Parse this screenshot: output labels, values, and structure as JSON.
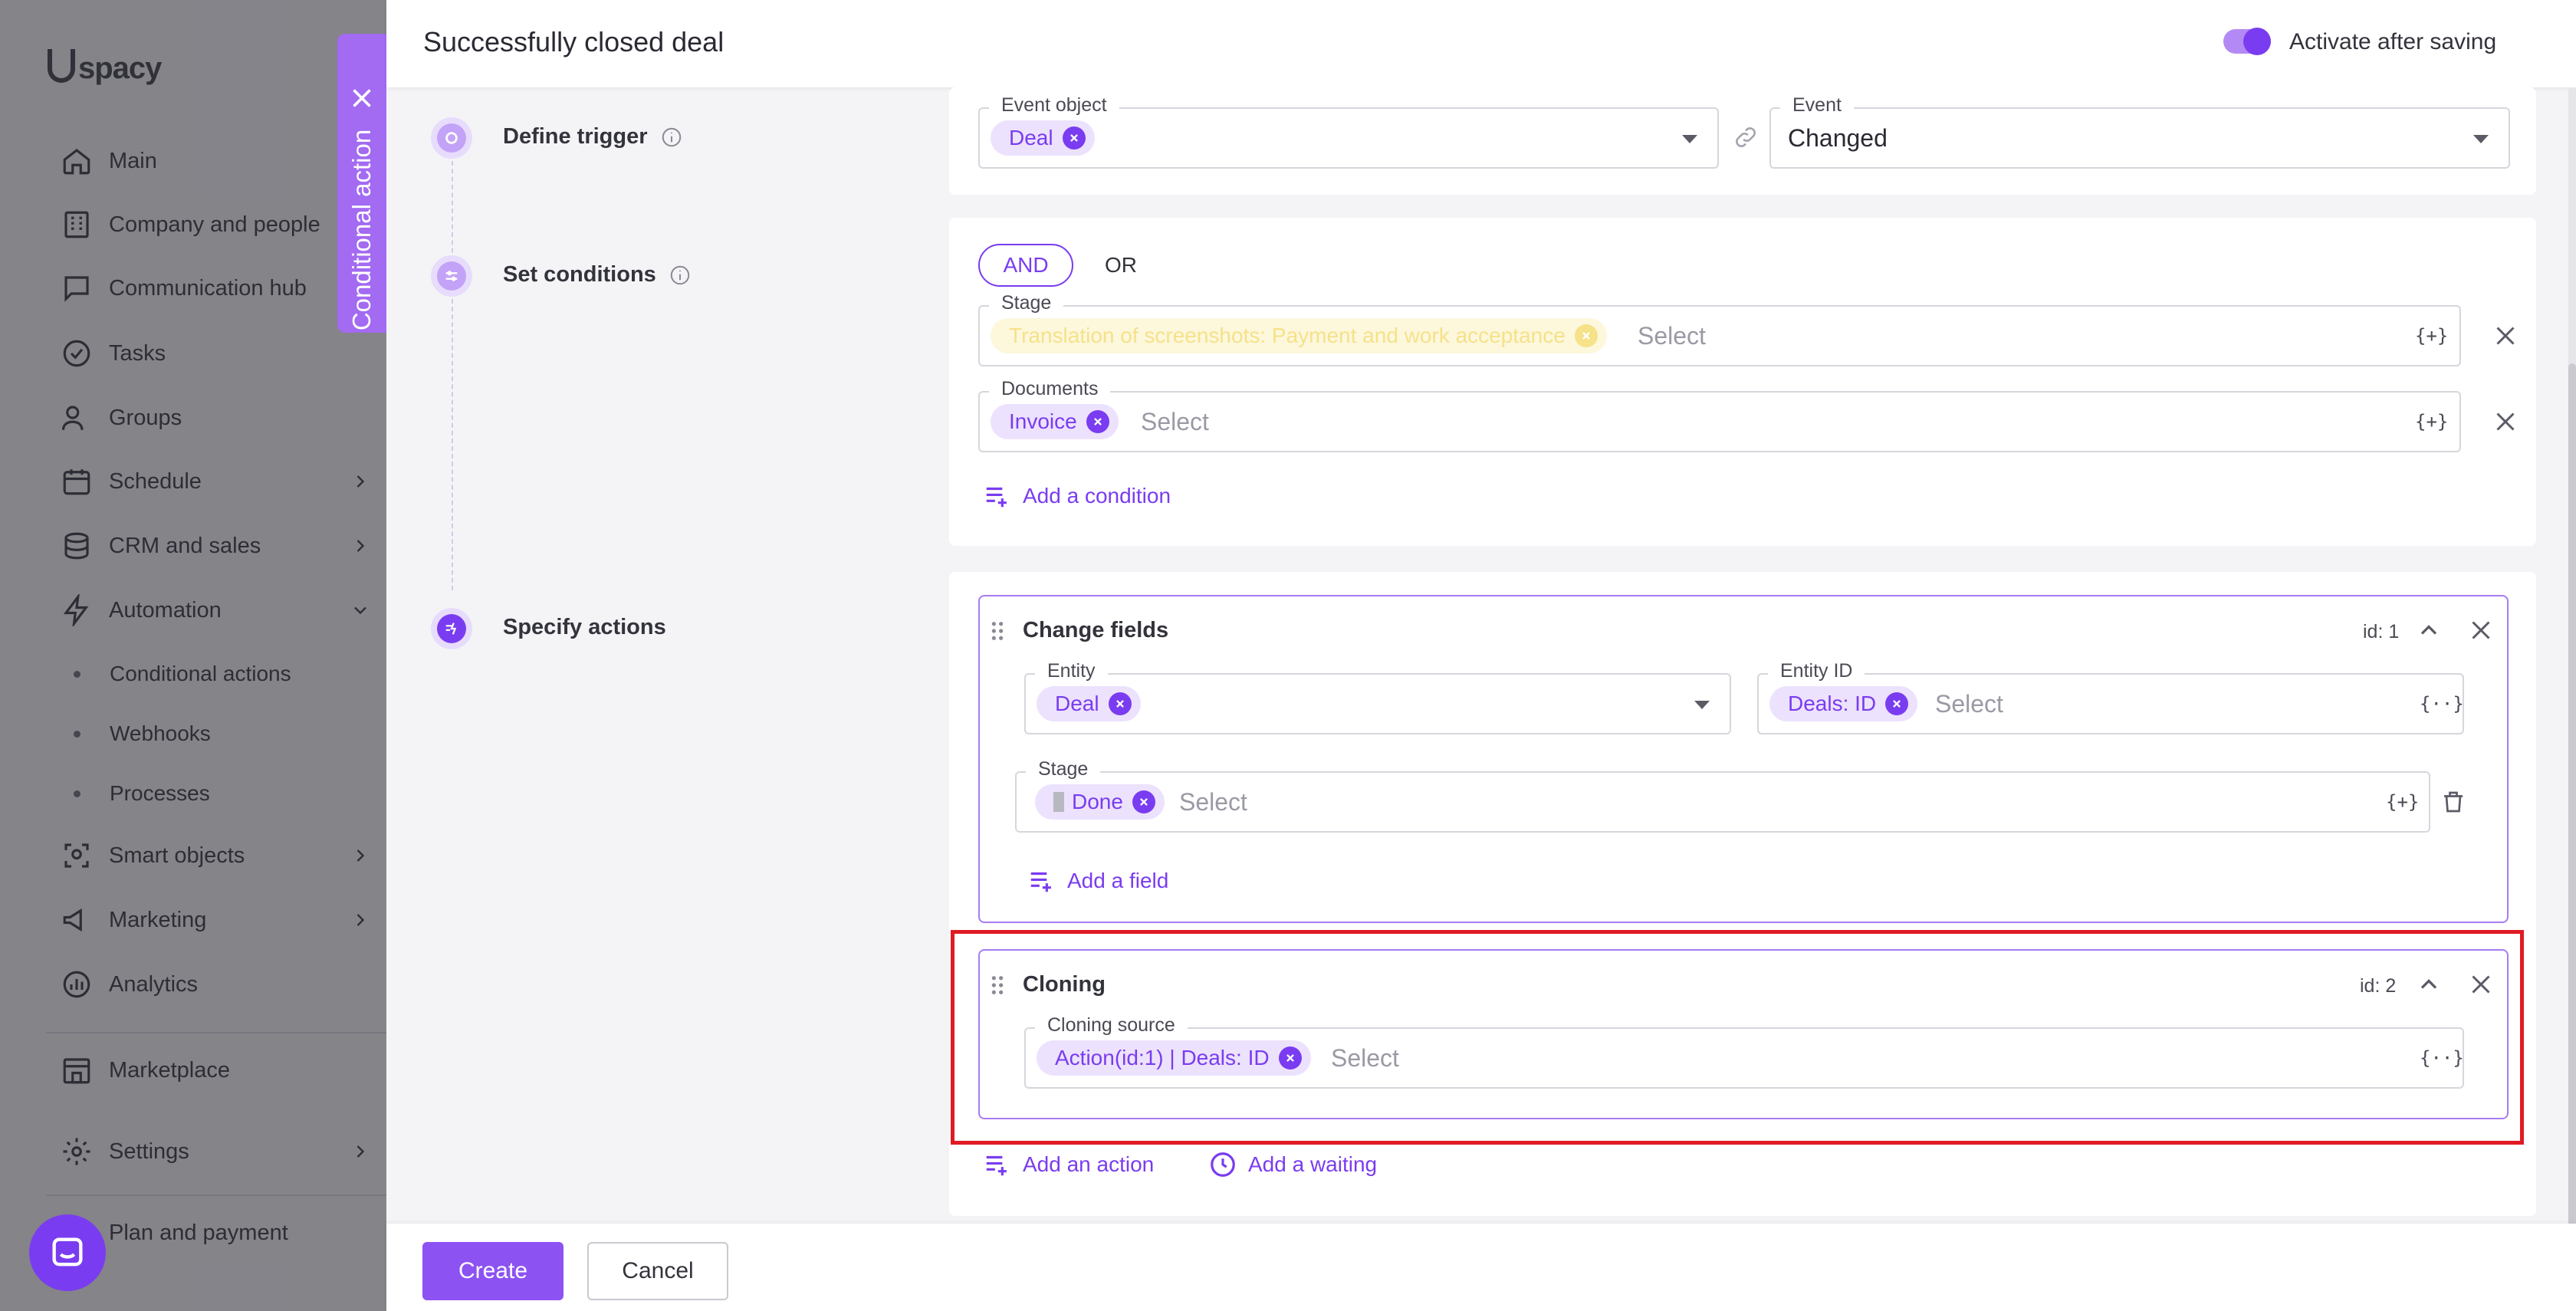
{
  "sidebar": {
    "logo": "spacy",
    "items": [
      {
        "label": "Main",
        "icon": "home-icon"
      },
      {
        "label": "Company and people",
        "icon": "building-icon"
      },
      {
        "label": "Communication hub",
        "icon": "chat-icon"
      },
      {
        "label": "Tasks",
        "icon": "check-circle-icon"
      },
      {
        "label": "Groups",
        "icon": "users-icon"
      },
      {
        "label": "Schedule",
        "icon": "calendar-icon"
      },
      {
        "label": "CRM and sales",
        "icon": "database-icon"
      },
      {
        "label": "Automation",
        "icon": "lightning-icon"
      },
      {
        "label": "Smart objects",
        "icon": "scan-icon"
      },
      {
        "label": "Marketing",
        "icon": "megaphone-icon"
      },
      {
        "label": "Analytics",
        "icon": "chart-icon"
      },
      {
        "label": "Marketplace",
        "icon": "store-icon"
      },
      {
        "label": "Settings",
        "icon": "gear-icon"
      },
      {
        "label": "Plan and payment",
        "icon": "card-icon"
      }
    ],
    "automation_sub": [
      "Conditional actions",
      "Webhooks",
      "Processes"
    ]
  },
  "vertical_tab": {
    "label": "Conditional action"
  },
  "header": {
    "title": "Successfully closed deal",
    "activate_label": "Activate after saving",
    "activate_on": true
  },
  "steps": {
    "trigger": "Define trigger",
    "conditions": "Set conditions",
    "actions": "Specify actions"
  },
  "trigger": {
    "event_object_label": "Event object",
    "event_object_chip": "Deal",
    "event_label": "Event",
    "event_value": "Changed"
  },
  "conditions": {
    "and_label": "AND",
    "or_label": "OR",
    "stage_label": "Stage",
    "stage_chip": "Translation of screenshots: Payment and work acceptance",
    "stage_placeholder": "Select",
    "documents_label": "Documents",
    "documents_chip": "Invoice",
    "documents_placeholder": "Select",
    "add_condition": "Add a condition",
    "var_token": "{+}"
  },
  "actions": {
    "change_fields": {
      "title": "Change fields",
      "id": "id: 1",
      "entity_label": "Entity",
      "entity_chip": "Deal",
      "entity_id_label": "Entity ID",
      "entity_id_chip": "Deals: ID",
      "entity_id_placeholder": "Select",
      "stage_label": "Stage",
      "stage_chip": "Done",
      "stage_placeholder": "Select",
      "add_field": "Add a field",
      "var_token_list": "{··}",
      "var_token_plus": "{+}"
    },
    "cloning": {
      "title": "Cloning",
      "id": "id: 2",
      "source_label": "Cloning source",
      "source_chip": "Action(id:1) | Deals: ID",
      "source_placeholder": "Select",
      "var_token": "{··}"
    },
    "add_action": "Add an action",
    "add_waiting": "Add a waiting"
  },
  "footer": {
    "create": "Create",
    "cancel": "Cancel"
  },
  "colors": {
    "accent": "#7a3cf0",
    "highlight": "#e01b24"
  }
}
